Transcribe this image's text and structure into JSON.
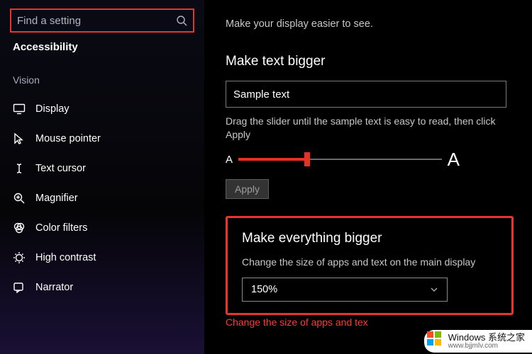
{
  "sidebar": {
    "search_placeholder": "Find a setting",
    "breadcrumb": "Accessibility",
    "category": "Vision",
    "items": [
      {
        "label": "Display"
      },
      {
        "label": "Mouse pointer"
      },
      {
        "label": "Text cursor"
      },
      {
        "label": "Magnifier"
      },
      {
        "label": "Color filters"
      },
      {
        "label": "High contrast"
      },
      {
        "label": "Narrator"
      }
    ]
  },
  "main": {
    "intro": "Make your display easier to see.",
    "text_section": {
      "heading": "Make text bigger",
      "sample": "Sample text",
      "instruction": "Drag the slider until the sample text is easy to read, then click Apply",
      "small_a": "A",
      "big_a": "A",
      "apply_label": "Apply"
    },
    "scale_section": {
      "heading": "Make everything bigger",
      "sub": "Change the size of apps and text on the main display",
      "value": "150%"
    },
    "cut_line": "Change the size of apps and tex"
  },
  "watermark": {
    "line1": "Windows 系统之家",
    "line2": "www.bjjmlv.com"
  }
}
